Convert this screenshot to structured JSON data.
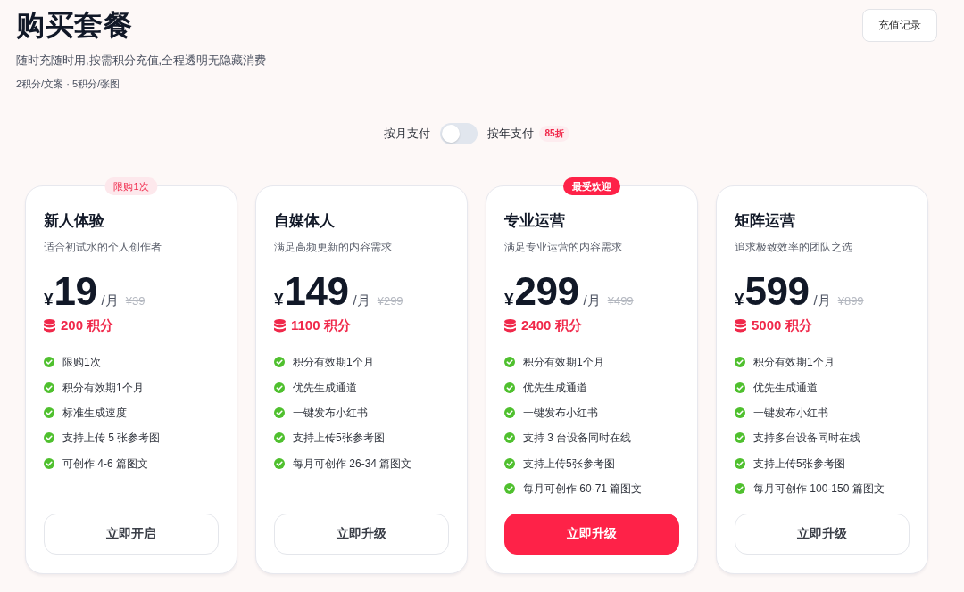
{
  "header": {
    "title": "购买套餐",
    "subtitle": "随时充随时用,按需积分充值,全程透明无隐藏消费",
    "rates": "2积分/文案 · 5积分/张图",
    "history_button": "充值记录"
  },
  "billing": {
    "monthly_label": "按月支付",
    "toggle_on": false,
    "yearly_label": "按年支付",
    "discount_badge": "85折"
  },
  "plans": [
    {
      "name": "新人体验",
      "description": "适合初试水的个人创作者",
      "currency": "¥",
      "price": "19",
      "period": "/月",
      "original_price": "¥39",
      "points": "200 积分",
      "badge": {
        "text": "限购1次",
        "kind": "limited"
      },
      "features": [
        "限购1次",
        "积分有效期1个月",
        "标准生成速度",
        "支持上传 5 张参考图",
        "可创作 4-6 篇图文"
      ],
      "button": {
        "label": "立即开启",
        "primary": false
      }
    },
    {
      "name": "自媒体人",
      "description": "满足高频更新的内容需求",
      "currency": "¥",
      "price": "149",
      "period": "/月",
      "original_price": "¥299",
      "points": "1100 积分",
      "features": [
        "积分有效期1个月",
        "优先生成通道",
        "一键发布小红书",
        "支持上传5张参考图",
        "每月可创作 26-34 篇图文"
      ],
      "button": {
        "label": "立即升级",
        "primary": false
      }
    },
    {
      "name": "专业运营",
      "description": "满足专业运营的内容需求",
      "currency": "¥",
      "price": "299",
      "period": "/月",
      "original_price": "¥499",
      "points": "2400 积分",
      "badge": {
        "text": "最受欢迎",
        "kind": "popular"
      },
      "features": [
        "积分有效期1个月",
        "优先生成通道",
        "一键发布小红书",
        "支持 3 台设备同时在线",
        "支持上传5张参考图",
        "每月可创作 60-71 篇图文"
      ],
      "button": {
        "label": "立即升级",
        "primary": true
      }
    },
    {
      "name": "矩阵运营",
      "description": "追求极致效率的团队之选",
      "currency": "¥",
      "price": "599",
      "period": "/月",
      "original_price": "¥899",
      "points": "5000 积分",
      "features": [
        "积分有效期1个月",
        "优先生成通道",
        "一键发布小红书",
        "支持多台设备同时在线",
        "支持上传5张参考图",
        "每月可创作 100-150 篇图文"
      ],
      "button": {
        "label": "立即升级",
        "primary": false
      }
    }
  ]
}
